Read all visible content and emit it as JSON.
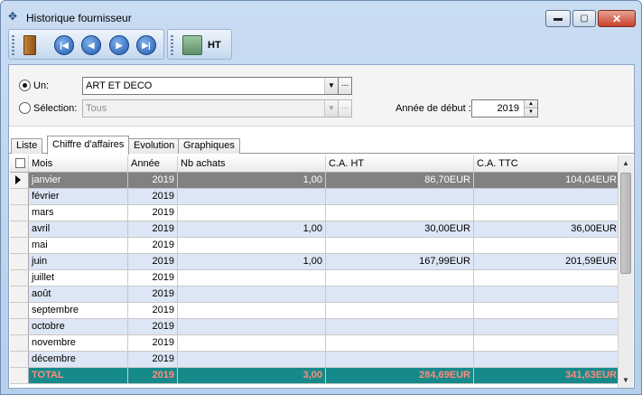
{
  "window": {
    "title": "Historique fournisseur",
    "minimize": "▬",
    "maximize": "▢",
    "close": "✕"
  },
  "toolbar": {
    "ht_label": "HT",
    "nav_icons": [
      "first-record-icon",
      "previous-record-icon",
      "next-record-icon",
      "last-record-icon"
    ],
    "first": "|◀",
    "prev": "◀",
    "next": "▶",
    "last": "▶|"
  },
  "filters": {
    "un_label": "Un:",
    "un_value": "ART ET DECO",
    "selection_label": "Sélection:",
    "selection_value": "Tous",
    "browse": "...",
    "annee_label": "Année de début :",
    "annee_value": "2019"
  },
  "tabs": [
    {
      "label": "Liste"
    },
    {
      "label": "Chiffre d'affaires"
    },
    {
      "label": "Evolution"
    },
    {
      "label": "Graphiques"
    }
  ],
  "grid": {
    "columns": [
      "Mois",
      "Année",
      "Nb achats",
      "C.A. HT",
      "C.A. TTC"
    ],
    "rows": [
      {
        "mois": "janvier",
        "annee": "2019",
        "nb": "1,00",
        "ht": "86,70EUR",
        "ttc": "104,04EUR"
      },
      {
        "mois": "février",
        "annee": "2019",
        "nb": "",
        "ht": "",
        "ttc": ""
      },
      {
        "mois": "mars",
        "annee": "2019",
        "nb": "",
        "ht": "",
        "ttc": ""
      },
      {
        "mois": "avril",
        "annee": "2019",
        "nb": "1,00",
        "ht": "30,00EUR",
        "ttc": "36,00EUR"
      },
      {
        "mois": "mai",
        "annee": "2019",
        "nb": "",
        "ht": "",
        "ttc": ""
      },
      {
        "mois": "juin",
        "annee": "2019",
        "nb": "1,00",
        "ht": "167,99EUR",
        "ttc": "201,59EUR"
      },
      {
        "mois": "juillet",
        "annee": "2019",
        "nb": "",
        "ht": "",
        "ttc": ""
      },
      {
        "mois": "août",
        "annee": "2019",
        "nb": "",
        "ht": "",
        "ttc": ""
      },
      {
        "mois": "septembre",
        "annee": "2019",
        "nb": "",
        "ht": "",
        "ttc": ""
      },
      {
        "mois": "octobre",
        "annee": "2019",
        "nb": "",
        "ht": "",
        "ttc": ""
      },
      {
        "mois": "novembre",
        "annee": "2019",
        "nb": "",
        "ht": "",
        "ttc": ""
      },
      {
        "mois": "décembre",
        "annee": "2019",
        "nb": "",
        "ht": "",
        "ttc": ""
      }
    ],
    "total": {
      "mois": "TOTAL",
      "annee": "2019",
      "nb": "3,00",
      "ht": "284,69EUR",
      "ttc": "341,63EUR"
    }
  },
  "colors": {
    "selected_row": "#818181",
    "alt_row": "#dce6f5",
    "total_bg": "#168a8a",
    "total_text": "#ff8c7c"
  }
}
